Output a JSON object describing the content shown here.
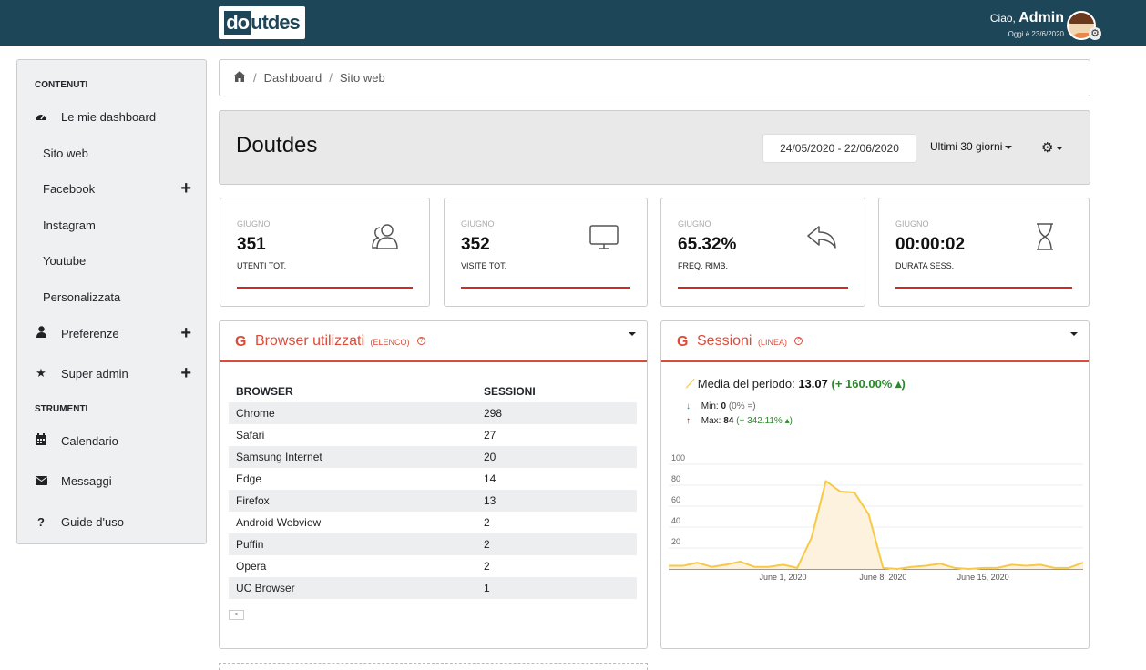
{
  "topbar": {
    "logo": {
      "part1": "do",
      "part2": "ut",
      "part3": "des"
    },
    "greeting": "Ciao,",
    "username": "Admin",
    "date": "Oggi è 23/6/2020"
  },
  "sidebar": {
    "section_contents": "CONTENUTI",
    "section_tools": "STRUMENTI",
    "items": [
      {
        "label": "Le mie dashboard",
        "icon": "tachometer-icon"
      },
      {
        "label": "Sito web"
      },
      {
        "label": "Facebook",
        "expandable": true
      },
      {
        "label": "Instagram"
      },
      {
        "label": "Youtube"
      },
      {
        "label": "Personalizzata"
      },
      {
        "label": "Preferenze",
        "icon": "user-icon",
        "expandable": true
      },
      {
        "label": "Super admin",
        "icon": "star-icon",
        "expandable": true
      },
      {
        "label": "Calendario",
        "icon": "calendar-icon"
      },
      {
        "label": "Messaggi",
        "icon": "envelope-icon"
      },
      {
        "label": "Guide d'uso",
        "icon": "question-icon"
      }
    ]
  },
  "breadcrumb": {
    "items": [
      "Dashboard",
      "Sito web"
    ]
  },
  "header": {
    "title": "Doutdes",
    "date_range": "24/05/2020 - 22/06/2020",
    "period": "Ultimi 30 giorni"
  },
  "kpis": [
    {
      "month": "GIUGNO",
      "value": "351",
      "label": "UTENTI TOT.",
      "icon": "users-icon"
    },
    {
      "month": "GIUGNO",
      "value": "352",
      "label": "VISITE TOT.",
      "icon": "desktop-icon"
    },
    {
      "month": "GIUGNO",
      "value": "65.32%",
      "label": "FREQ. RIMB.",
      "icon": "reply-icon"
    },
    {
      "month": "GIUGNO",
      "value": "00:00:02",
      "label": "DURATA SESS.",
      "icon": "hourglass-icon"
    }
  ],
  "browsers_panel": {
    "title": "Browser utilizzati",
    "subtitle": "(ELENCO)",
    "columns": [
      "BROWSER",
      "SESSIONI"
    ],
    "rows": [
      [
        "Chrome",
        "298"
      ],
      [
        "Safari",
        "27"
      ],
      [
        "Samsung Internet",
        "20"
      ],
      [
        "Edge",
        "14"
      ],
      [
        "Firefox",
        "13"
      ],
      [
        "Android Webview",
        "2"
      ],
      [
        "Puffin",
        "2"
      ],
      [
        "Opera",
        "2"
      ],
      [
        "UC Browser",
        "1"
      ]
    ]
  },
  "sessions_panel": {
    "title": "Sessioni",
    "subtitle": "(LINEA)",
    "media_label": "Media del periodo:",
    "media_value": "13.07",
    "media_change": "(+ 160.00% ▴)",
    "min_label": "Min:",
    "min_value": "0",
    "min_change": "(0% =)",
    "max_label": "Max:",
    "max_value": "84",
    "max_change": "(+ 342.11% ▴)"
  },
  "chart_data": {
    "type": "area",
    "x": [
      "2020-05-24",
      "2020-05-25",
      "2020-05-26",
      "2020-05-27",
      "2020-05-28",
      "2020-05-29",
      "2020-05-30",
      "2020-05-31",
      "2020-06-01",
      "2020-06-02",
      "2020-06-03",
      "2020-06-04",
      "2020-06-05",
      "2020-06-06",
      "2020-06-07",
      "2020-06-08",
      "2020-06-09",
      "2020-06-10",
      "2020-06-11",
      "2020-06-12",
      "2020-06-13",
      "2020-06-14",
      "2020-06-15",
      "2020-06-16",
      "2020-06-17",
      "2020-06-18",
      "2020-06-19",
      "2020-06-20",
      "2020-06-21",
      "2020-06-22"
    ],
    "values": [
      3,
      3,
      6,
      2,
      4,
      7,
      2,
      2,
      4,
      1,
      30,
      84,
      74,
      73,
      52,
      1,
      0,
      2,
      3,
      5,
      1,
      0,
      1,
      1,
      4,
      3,
      4,
      1,
      1,
      6
    ],
    "tick_labels": [
      "June 1, 2020",
      "June 8, 2020",
      "June 15, 2020"
    ],
    "tick_dates": [
      "2020-06-01",
      "2020-06-08",
      "2020-06-15"
    ],
    "y_ticks": [
      20,
      40,
      60,
      80,
      100
    ],
    "ylim": [
      0,
      100
    ],
    "grid": true,
    "colors": {
      "line": "#f7c948",
      "fill": "#fcf2dd"
    }
  }
}
